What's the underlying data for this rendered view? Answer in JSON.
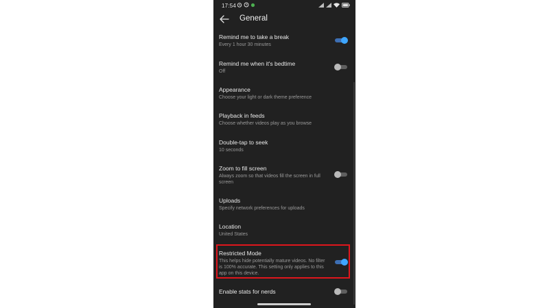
{
  "status_bar": {
    "time": "17:54",
    "left_icons": [
      "alarm-icon",
      "clock-icon",
      "notification-dot-icon"
    ],
    "right_icons": [
      "signal-icon",
      "signal-icon",
      "wifi-icon",
      "battery-icon"
    ]
  },
  "header": {
    "back_icon": "arrow-left-icon",
    "title": "General"
  },
  "settings": [
    {
      "title": "Remind me to take a break",
      "subtitle": "Every 1 hour 30 minutes",
      "toggle": "on"
    },
    {
      "title": "Remind me when it's bedtime",
      "subtitle": "Off",
      "toggle": "off"
    },
    {
      "title": "Appearance",
      "subtitle": "Choose your light or dark theme preference",
      "toggle": null
    },
    {
      "title": "Playback in feeds",
      "subtitle": "Choose whether videos play as you browse",
      "toggle": null
    },
    {
      "title": "Double-tap to seek",
      "subtitle": "10 seconds",
      "toggle": null
    },
    {
      "title": "Zoom to fill screen",
      "subtitle": "Always zoom so that videos fill the screen in full screen",
      "toggle": "off"
    },
    {
      "title": "Uploads",
      "subtitle": "Specify network preferences for uploads",
      "toggle": null
    },
    {
      "title": "Location",
      "subtitle": "United States",
      "toggle": null
    },
    {
      "title": "Restricted Mode",
      "subtitle": "This helps hide potentially mature videos. No filter is 100% accurate. This setting only applies to this app on this device.",
      "toggle": "on",
      "highlighted": true
    },
    {
      "title": "Enable stats for nerds",
      "subtitle": "",
      "toggle": "off"
    }
  ],
  "colors": {
    "background": "#212121",
    "toggle_on": "#3ea6ff",
    "highlight_border": "#e0161c"
  }
}
